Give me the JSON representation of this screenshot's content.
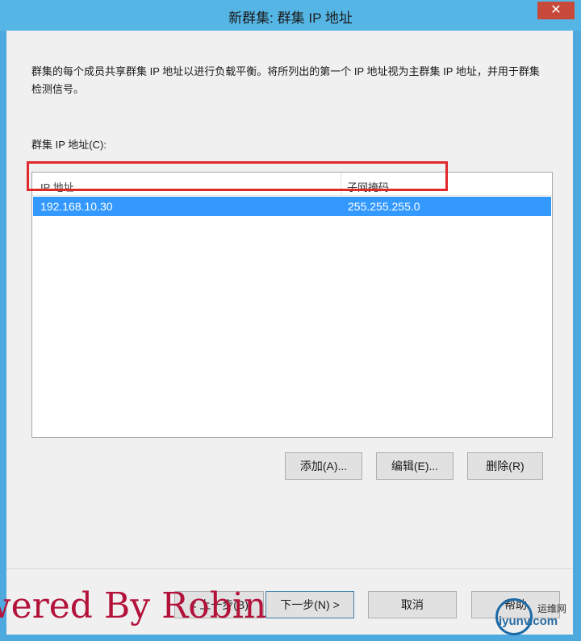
{
  "window": {
    "title": "新群集: 群集 IP 地址",
    "close_glyph": "✕"
  },
  "content": {
    "description": "群集的每个成员共享群集 IP 地址以进行负载平衡。将所列出的第一个 IP 地址视为主群集 IP 地址，并用于群集检测信号。",
    "list_label": "群集 IP 地址(C):"
  },
  "listview": {
    "columns": [
      "IP 地址",
      "子网掩码"
    ],
    "rows": [
      {
        "ip": "192.168.10.30",
        "mask": "255.255.255.0",
        "selected": true
      }
    ]
  },
  "buttons": {
    "add": "添加(A)...",
    "edit": "编辑(E)...",
    "delete": "删除(R)",
    "back": "< 上一步(B)",
    "next": "下一步(N) >",
    "cancel": "取消",
    "help": "帮助"
  },
  "overlays": {
    "watermark": "wered By Robin",
    "logo_top": "运维网",
    "logo_bottom": "iyunv.com"
  },
  "colors": {
    "title_bar": "#55b6e6",
    "selection": "#3399ff",
    "highlight_box": "#e0282d"
  }
}
